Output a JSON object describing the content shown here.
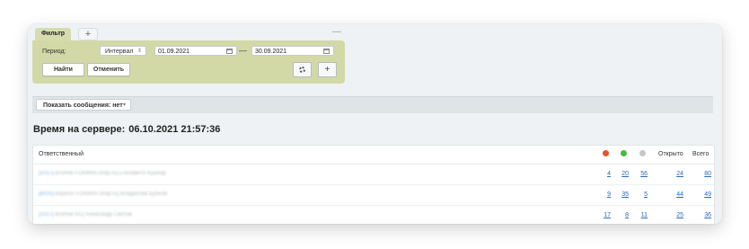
{
  "filter": {
    "tab_label": "Фильтр",
    "add_tab_symbol": "+",
    "collapse_symbol": "—",
    "period_label": "Период:",
    "period_type": "Интервал",
    "date_from": "01.09.2021",
    "date_separator": "—",
    "date_to": "30.09.2021",
    "find_label": "Найти",
    "cancel_label": "Отменить",
    "add_symbol": "+"
  },
  "messages": {
    "button_label": "Показать сообщения: нет"
  },
  "server_time": {
    "label": "Время на сервере:",
    "value": "06.10.2021 21:57:36"
  },
  "table": {
    "headers": {
      "responsible": "Ответственный",
      "open": "Открыто",
      "total": "Всего"
    },
    "status_colors": {
      "red": "#e8502f",
      "green": "#46b93d",
      "gray": "#c4c8cb"
    },
    "rows": [
      {
        "id": "[1017]",
        "name": "Bruhnik FORMmr.shop.ru] Елизавета Кушнар",
        "red": "4",
        "green": "20",
        "gray": "56",
        "open": "24",
        "total": "80"
      },
      {
        "id": "[8020]",
        "name": "Bilyarov FORMmr.shop.ru] Владислав Бубнов",
        "red": "9",
        "green": "35",
        "gray": "5",
        "open": "44",
        "total": "49"
      },
      {
        "id": "[1017]",
        "name": "Bruhnik RC] Александр Святов",
        "red": "17",
        "green": "8",
        "gray": "11",
        "open": "25",
        "total": "36"
      }
    ]
  }
}
